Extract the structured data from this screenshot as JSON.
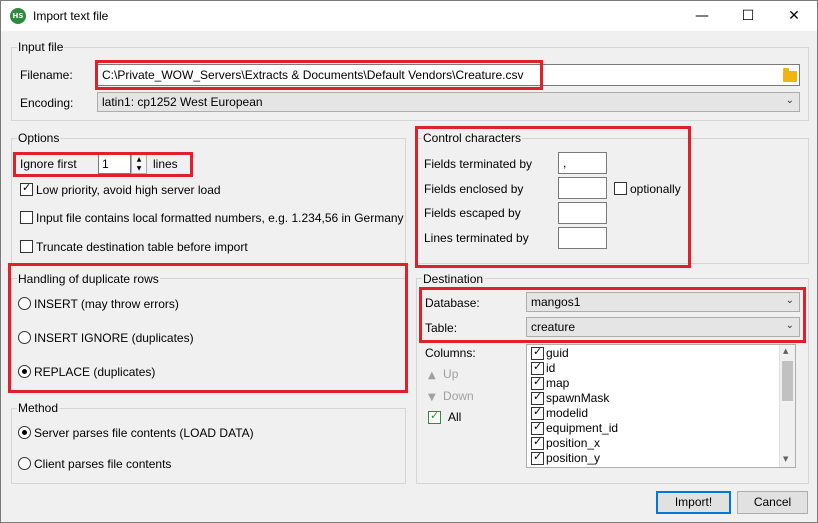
{
  "window": {
    "title": "Import text file",
    "minimize": "—",
    "maximize": "☐",
    "close": "✕"
  },
  "input_file": {
    "group_label": "Input file",
    "filename_label": "Filename:",
    "filename_value": "C:\\Private_WOW_Servers\\Extracts & Documents\\Default Vendors\\Creature.csv",
    "encoding_label": "Encoding:",
    "encoding_value": "latin1: cp1252 West European"
  },
  "options": {
    "group_label": "Options",
    "ignore_first_label": "Ignore first",
    "ignore_first_value": "1",
    "lines_label": "lines",
    "low_priority_label": "Low priority, avoid high server load",
    "low_priority_checked": true,
    "local_numbers_label": "Input file contains local formatted numbers, e.g. 1.234,56 in Germany",
    "local_numbers_checked": false,
    "truncate_label": "Truncate destination table before import",
    "truncate_checked": false
  },
  "duplicates": {
    "group_label": "Handling of duplicate rows",
    "insert_label": "INSERT (may throw errors)",
    "insert_ignore_label": "INSERT IGNORE (duplicates)",
    "replace_label": "REPLACE (duplicates)",
    "selected": "replace"
  },
  "method": {
    "group_label": "Method",
    "server_label": "Server parses file contents (LOAD DATA)",
    "client_label": "Client parses file contents",
    "selected": "server"
  },
  "control_chars": {
    "group_label": "Control characters",
    "fields_terminated_label": "Fields terminated by",
    "fields_terminated_value": ",",
    "fields_enclosed_label": "Fields enclosed by",
    "fields_enclosed_value": "",
    "optionally_label": "optionally",
    "optionally_checked": false,
    "fields_escaped_label": "Fields escaped by",
    "fields_escaped_value": "",
    "lines_terminated_label": "Lines terminated by",
    "lines_terminated_value": ""
  },
  "destination": {
    "group_label": "Destination",
    "database_label": "Database:",
    "database_value": "mangos1",
    "table_label": "Table:",
    "table_value": "creature",
    "columns_label": "Columns:",
    "up_label": "Up",
    "down_label": "Down",
    "all_label": "All",
    "columns": [
      "guid",
      "id",
      "map",
      "spawnMask",
      "modelid",
      "equipment_id",
      "position_x",
      "position_y"
    ]
  },
  "buttons": {
    "import": "Import!",
    "cancel": "Cancel"
  }
}
